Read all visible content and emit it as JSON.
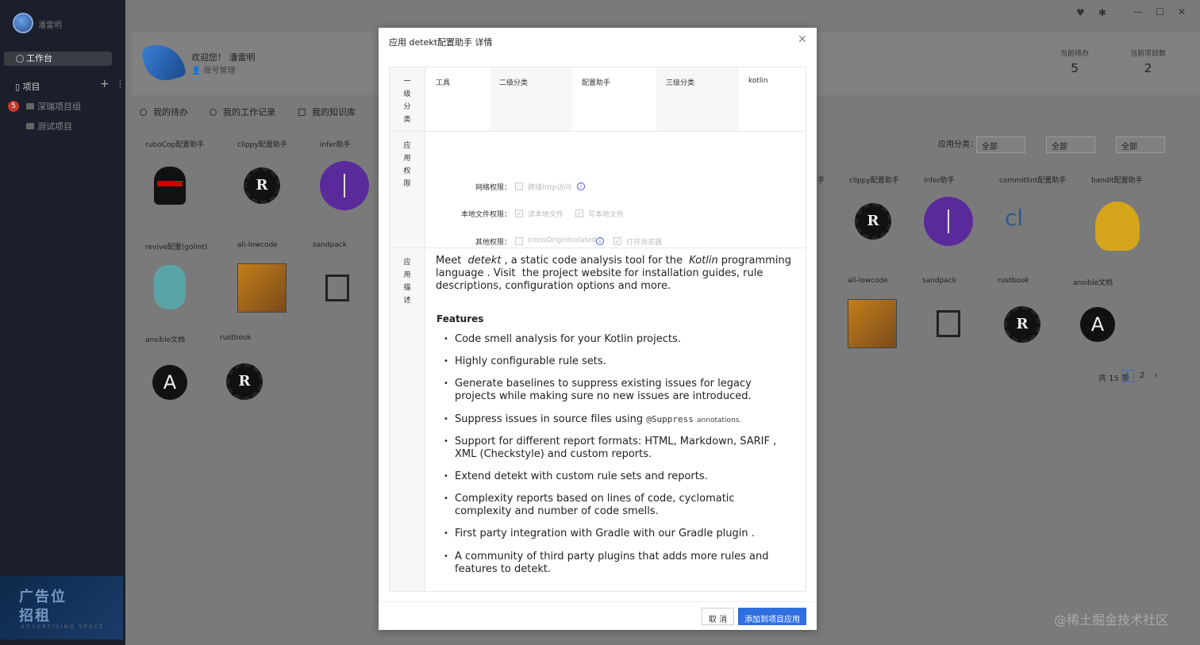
{
  "sidebar": {
    "user": "潘雷明",
    "workbench": "工作台",
    "projects_label": "项目",
    "badge": "5",
    "items": [
      {
        "label": "深瑞项目组"
      },
      {
        "label": "测试项目"
      }
    ],
    "ad": {
      "line1": "广告位",
      "line2": "招租",
      "line3": "ADVERTISING SPACE"
    }
  },
  "header": {
    "welcome": "欢迎您！ 潘雷明",
    "account": "账号管理",
    "stats": [
      {
        "label": "当前待办",
        "value": "5"
      },
      {
        "label": "当前项目数",
        "value": "2"
      }
    ]
  },
  "tabs": [
    {
      "label": "我的待办"
    },
    {
      "label": "我的工作记录"
    },
    {
      "label": "我的知识库"
    }
  ],
  "filters": {
    "label": "应用分类：",
    "sel1": "全部",
    "sel2": "全部",
    "sel3": "全部"
  },
  "left_apps": [
    "ruboCop配置助手",
    "clippy配置助手",
    "infer助手",
    "revive配置(golint)",
    "ali-lowcode",
    "sandpack",
    "ansible文档",
    "rustbook"
  ],
  "right_apps": [
    "手",
    "clippy配置助手",
    "infer助手",
    "commitlint配置助手",
    "bandit配置助手",
    "ali-lowcode",
    "sandpack",
    "rustbook",
    "ansible文档"
  ],
  "pager": {
    "total": "共 15 条",
    "page1": "1",
    "page2": "2"
  },
  "watermark": "@稀土掘金技术社区",
  "modal": {
    "title": "应用 detekt配置助手 详情",
    "row1_head": [
      "一",
      "级",
      "分",
      "类"
    ],
    "row2_head": [
      "应",
      "用",
      "权",
      "限"
    ],
    "row3_head": [
      "应",
      "用",
      "描",
      "述"
    ],
    "categories": [
      "工具",
      "二级分类",
      "配置助手",
      "三级分类",
      "kotlin"
    ],
    "permissions": {
      "network_label": "网络权限：",
      "network_opt": "跨域http访问",
      "local_label": "本地文件权限：",
      "local_opt1": "读本地文件",
      "local_opt2": "写本地文件",
      "other_label": "其他权限：",
      "other_opt1": "crossOriginIsolated",
      "other_opt2": "打开浏览器"
    },
    "desc": {
      "meet": "Meet",
      "detekt": "detekt",
      "p1": ", a static code analysis tool for the",
      "kotlin": "Kotlin",
      "p2": "programming language . Visit",
      "website": "the project website",
      "p3": "for installation guides, rule descriptions, configuration options and more."
    },
    "features_title": "Features",
    "features": [
      "Code smell analysis for your  Kotlin  projects.",
      "Highly configurable rule sets.",
      "Generate baselines to suppress existing issues for legacy projects while making sure no new issues are introduced.",
      "Suppress issues in source files using",
      "Support for different report formats: HTML, Markdown,  SARIF , XML (Checkstyle) and custom reports.",
      "Extend detekt  with custom rule sets and reports.",
      "Complexity reports based on lines of code, cyclomatic complexity and number of code smells.",
      "First party integration with Gradle with our  Gradle plugin .",
      "A community of  third party plugins  that adds more rules and features to detekt."
    ],
    "suppress_code": "@Suppress",
    "suppress_tail": "annotations.",
    "cancel": "取 消",
    "add": "添加到项目应用"
  }
}
